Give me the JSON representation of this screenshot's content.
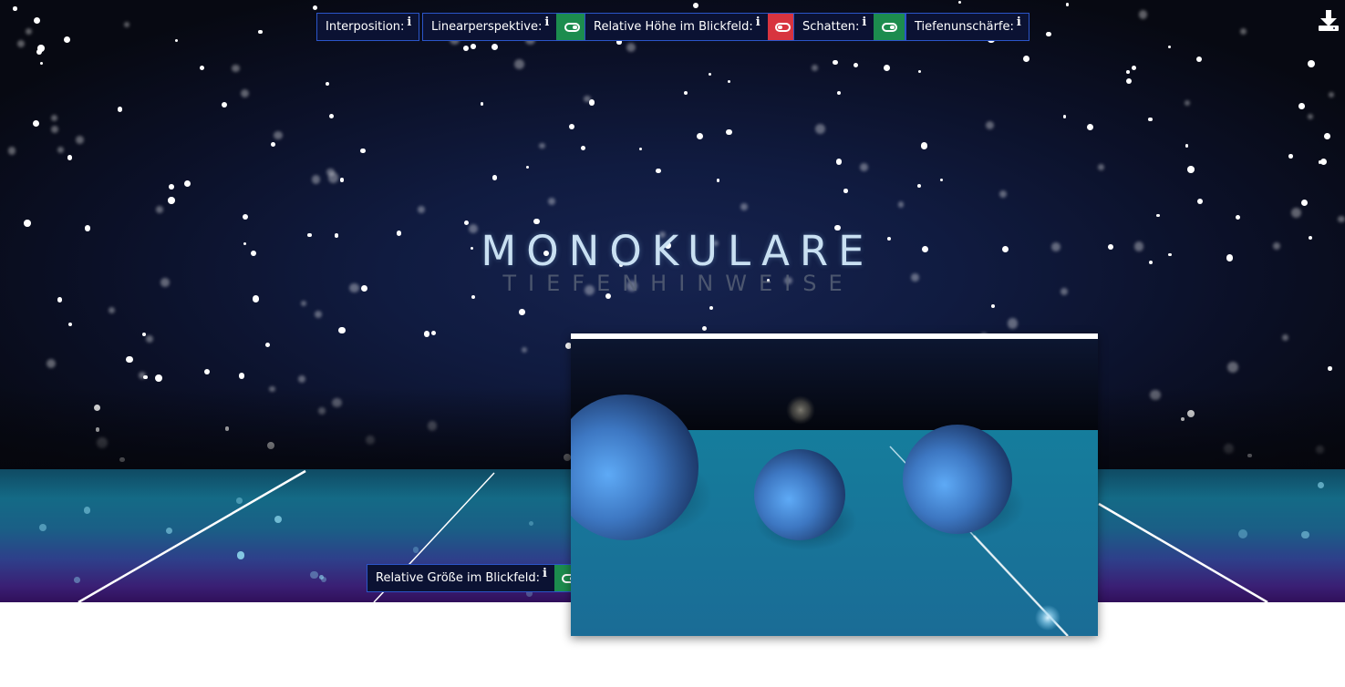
{
  "title": "MONOKULARE",
  "subtitle": "TIEFENHINWEISE",
  "cues": [
    {
      "label": "Interposition:",
      "info": "i",
      "toggle": null
    },
    {
      "label": "Linearperspektive:",
      "info": "i",
      "toggle": "on"
    },
    {
      "label": "Relative Höhe im Blickfeld:",
      "info": "i",
      "toggle": "off"
    },
    {
      "label": "Schatten:",
      "info": "i",
      "toggle": "on"
    },
    {
      "label": "Tiefenunschärfe:",
      "info": "i",
      "toggle": null
    },
    {
      "label": "Relative Größe im Blickfeld:",
      "info": "i",
      "toggle": "on"
    }
  ],
  "colors": {
    "toggle_on": "#1c8c4e",
    "toggle_off": "#d8343f",
    "cue_border": "#2b55c9",
    "title": "#c9e0f2"
  },
  "icons": {
    "download": "download-icon",
    "toggle_on": "toggle-on-icon",
    "toggle_off": "toggle-off-icon",
    "info": "info-icon"
  }
}
